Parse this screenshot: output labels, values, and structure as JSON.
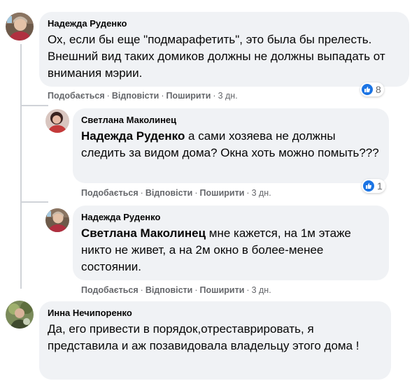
{
  "comments": [
    {
      "author": "Надежда Руденко",
      "text": "Ох, если бы еще \"подмарафетить\", это была бы прелесть. Внешний вид таких домиков должны не должны выпадать от внимания мэрии.",
      "actions": {
        "like": "Подобається",
        "reply": "Відповісти",
        "share": "Поширити",
        "time": "3 дн."
      },
      "reactions_count": "8"
    },
    {
      "author": "Светлана Маколинец",
      "mention": "Надежда Руденко",
      "text": " а сами хозяева не должны следить за видом дома? Окна хоть можно помыть???",
      "actions": {
        "like": "Подобається",
        "reply": "Відповісти",
        "share": "Поширити",
        "time": "3 дн."
      },
      "reactions_count": "1"
    },
    {
      "author": "Надежда Руденко",
      "mention": "Светлана Маколинец",
      "text": " мне кажется, на 1м этаже никто не живет, а на 2м окно в более-менее состоянии.",
      "actions": {
        "like": "Подобається",
        "reply": "Відповісти",
        "share": "Поширити",
        "time": "3 дн."
      }
    },
    {
      "author": "Инна Нечипоренко",
      "text": "Да, его привести в порядок,отреставрировать, я представила и аж позавидовала владельцу этого дома !"
    }
  ],
  "separator": "·",
  "colors": {
    "bubble": "#f0f2f5",
    "meta": "#65676b",
    "like_blue": "#1b74e4"
  }
}
